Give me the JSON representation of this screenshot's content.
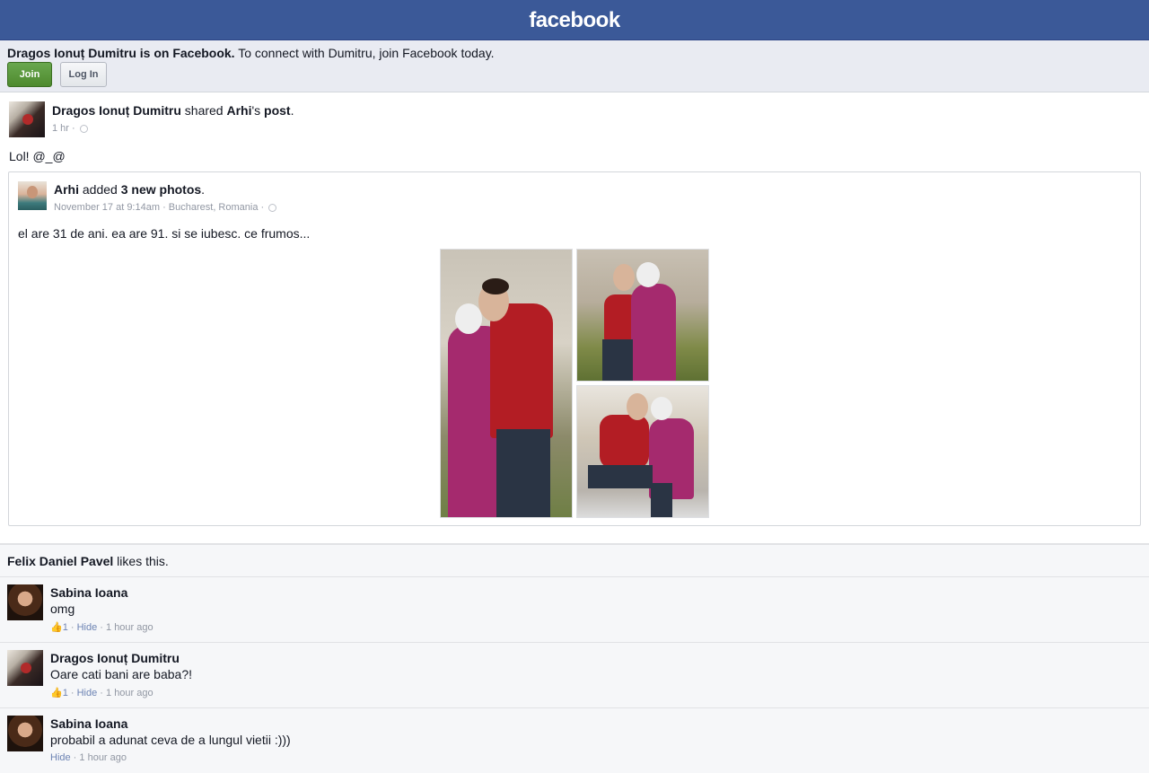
{
  "header": {
    "logo": "facebook"
  },
  "join_bar": {
    "name_part": "Dragos Ionuț Dumitru is on Facebook.",
    "rest_part": " To connect with Dumitru, join Facebook today.",
    "join_label": "Join",
    "login_label": "Log In"
  },
  "story": {
    "actor": "Dragos Ionuț Dumitru",
    "shared_word": " shared ",
    "owner": "Arhi",
    "owner_suffix": "'s ",
    "post_word": "post",
    "period": ".",
    "time": "1 hr",
    "dot": " · ",
    "message": "Lol! @_@"
  },
  "shared_post": {
    "actor": "Arhi",
    "added_word": " added ",
    "photos_word": "3 new photos",
    "period": ".",
    "date": "November 17 at 9:14am",
    "location": "Bucharest, Romania",
    "dot": " · ",
    "message": "el are 31 de ani. ea are 91. si se iubesc. ce frumos..."
  },
  "likes": {
    "name": "Felix Daniel Pavel",
    "text": " likes this."
  },
  "comments": [
    {
      "name": "Sabina Ioana",
      "body": "omg",
      "like_count": "1",
      "hide": "Hide",
      "time": "1 hour ago"
    },
    {
      "name": "Dragos Ionuț Dumitru",
      "body": "Oare cati bani are baba?!",
      "like_count": "1",
      "hide": "Hide",
      "time": "1 hour ago"
    },
    {
      "name": "Sabina Ioana",
      "body": "probabil a adunat ceva de a lungul vietii :)))",
      "hide": "Hide",
      "time": "1 hour ago"
    }
  ],
  "colors": {
    "brand": "#3b5998",
    "join_green": "#5b9a36",
    "link": "#6d84b4"
  }
}
